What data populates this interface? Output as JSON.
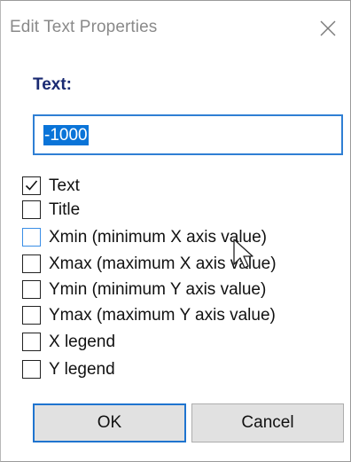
{
  "dialog": {
    "title": "Edit Text Properties",
    "close_icon": "close-icon"
  },
  "field": {
    "label": "Text:",
    "value": "-1000",
    "value_selected": true
  },
  "checkboxes": [
    {
      "label": "Text",
      "checked": true
    },
    {
      "label": "Title",
      "checked": false
    },
    {
      "label": "Xmin (minimum X axis value)",
      "checked": false,
      "hovered": true
    },
    {
      "label": "Xmax (maximum X axis value)",
      "checked": false
    },
    {
      "label": "Ymin (minimum Y axis value)",
      "checked": false
    },
    {
      "label": "Ymax (maximum Y axis value)",
      "checked": false
    },
    {
      "label": "X legend",
      "checked": false
    },
    {
      "label": "Y legend",
      "checked": false
    }
  ],
  "buttons": {
    "ok_label": "OK",
    "cancel_label": "Cancel"
  },
  "colors": {
    "accent": "#0a74d8",
    "label_blue": "#1a2a72",
    "button_bg": "#e1e1e1"
  }
}
